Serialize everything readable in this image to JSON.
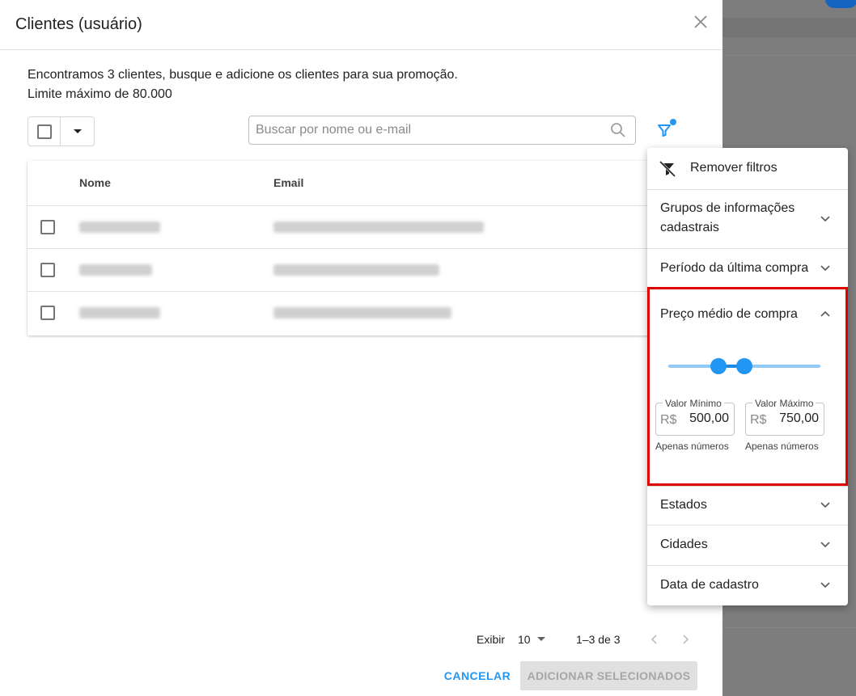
{
  "dialog": {
    "title": "Clientes (usuário)",
    "description_line1": "Encontramos 3 clientes, busque e adicione os clientes para sua promoção.",
    "description_line2": "Limite máximo de 80.000"
  },
  "search": {
    "placeholder": "Buscar por nome ou e-mail"
  },
  "table": {
    "columns": [
      "Nome",
      "Email"
    ],
    "rows": [
      {
        "name": "",
        "email": ""
      },
      {
        "name": "",
        "email": ""
      },
      {
        "name": "",
        "email": ""
      }
    ]
  },
  "filter_menu": {
    "remove_label": "Remover filtros",
    "items": [
      {
        "label": "Grupos de informações cadastrais",
        "expanded": false
      },
      {
        "label": "Período da última compra",
        "expanded": false
      },
      {
        "label": "Preço médio de compra",
        "expanded": true
      },
      {
        "label": "Estados",
        "expanded": false
      },
      {
        "label": "Cidades",
        "expanded": false
      },
      {
        "label": "Data de cadastro",
        "expanded": false
      }
    ],
    "price_range": {
      "min_legend": "Valor Mínimo",
      "max_legend": "Valor Máximo",
      "currency": "R$",
      "min_value": "500,00",
      "max_value": "750,00",
      "helper": "Apenas números",
      "slider_low_fraction": 0.33,
      "slider_high_fraction": 0.5
    }
  },
  "pagination": {
    "show_label": "Exibir",
    "page_size": "10",
    "range_label": "1–3 de 3"
  },
  "actions": {
    "cancel_label": "CANCELAR",
    "add_label": "ADICIONAR SELECIONADOS"
  },
  "colors": {
    "accent": "#2196f3",
    "highlight": "#e00000"
  }
}
